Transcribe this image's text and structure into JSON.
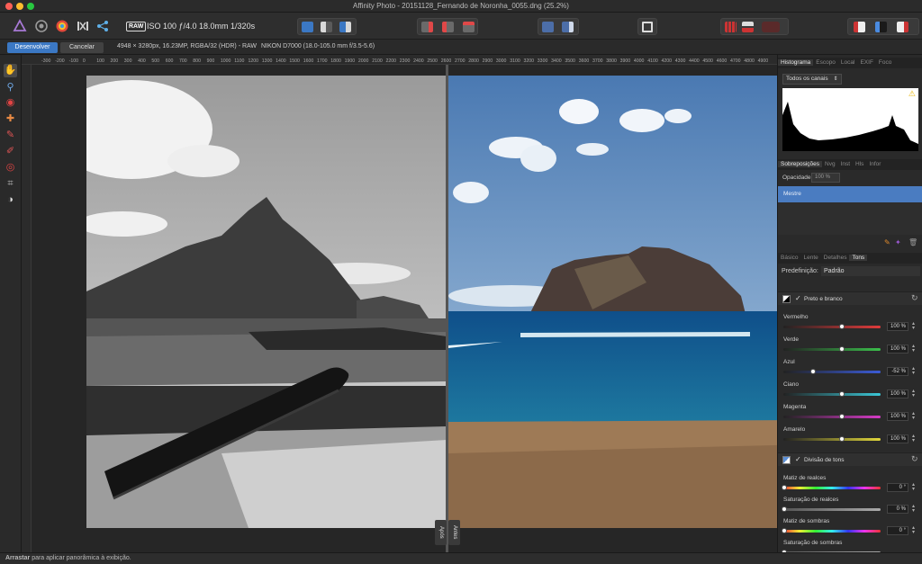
{
  "window": {
    "title": "Affinity Photo - 20151128_Fernando de Noronha_0055.dng (25.2%)"
  },
  "toolbar": {
    "raw_badge": "RAW",
    "exif_info": "ISO 100 ƒ/4.0 18.0mm 1/320s"
  },
  "context": {
    "develop_label": "Desenvolver",
    "cancel_label": "Cancelar",
    "image_info": "4948 × 3280px, 16.23MP, RGBA/32 (HDR) - RAW",
    "camera_info": "NIKON D7000 (18.0-105.0 mm f/3.5-5.6)"
  },
  "ruler": {
    "ticks": [
      "-300",
      "-200",
      "-100",
      "0",
      "100",
      "200",
      "300",
      "400",
      "500",
      "600",
      "700",
      "800",
      "900",
      "1000",
      "1100",
      "1200",
      "1300",
      "1400",
      "1500",
      "1600",
      "1700",
      "1800",
      "1900",
      "2000",
      "2100",
      "2200",
      "2300",
      "2400",
      "2500",
      "2600",
      "2700",
      "2800",
      "2900",
      "3000",
      "3100",
      "3200",
      "3300",
      "3400",
      "3500",
      "3600",
      "3700",
      "3800",
      "3900",
      "4000",
      "4100",
      "4200",
      "4300",
      "4400",
      "4500",
      "4600",
      "4700",
      "4800",
      "4900"
    ]
  },
  "canvas": {
    "after_tag": "Após",
    "before_tag": "Antes"
  },
  "panel": {
    "top_tabs": [
      "Histograma",
      "Escopo",
      "Local",
      "EXIF",
      "Foco"
    ],
    "channels_select": "Todos os canais",
    "overlay_tabs": [
      "Sobreposições",
      "Nvg",
      "Inst",
      "Hls",
      "Infor"
    ],
    "opacity_label": "Opacidade:",
    "opacity_value": "100 %",
    "mestre_label": "Mestre",
    "dev_tabs": [
      "Básico",
      "Lente",
      "Detalhes",
      "Tons"
    ],
    "preset_label": "Predefinição:",
    "preset_value": "Padrão",
    "bw_title": "Preto e branco",
    "bw_sliders": [
      {
        "label": "Vermelho",
        "value": "100 %"
      },
      {
        "label": "Verde",
        "value": "100 %"
      },
      {
        "label": "Azul",
        "value": "-52 %"
      },
      {
        "label": "Ciano",
        "value": "100 %"
      },
      {
        "label": "Magenta",
        "value": "100 %"
      },
      {
        "label": "Amarelo",
        "value": "100 %"
      }
    ],
    "split_title": "Divisão de tons",
    "split_sliders": [
      {
        "label": "Matiz de realces",
        "value": "0 °"
      },
      {
        "label": "Saturação de realces",
        "value": "0 %"
      },
      {
        "label": "Matiz de sombras",
        "value": "0 °"
      },
      {
        "label": "Saturação de sombras",
        "value": ""
      }
    ]
  },
  "status": {
    "bold": "Arrastar",
    "text": " para aplicar panorâmica à exibição."
  },
  "colors": {
    "accent": "#3b78c4",
    "mestre_row": "#4a7cc1",
    "warning": "#e8b400"
  }
}
